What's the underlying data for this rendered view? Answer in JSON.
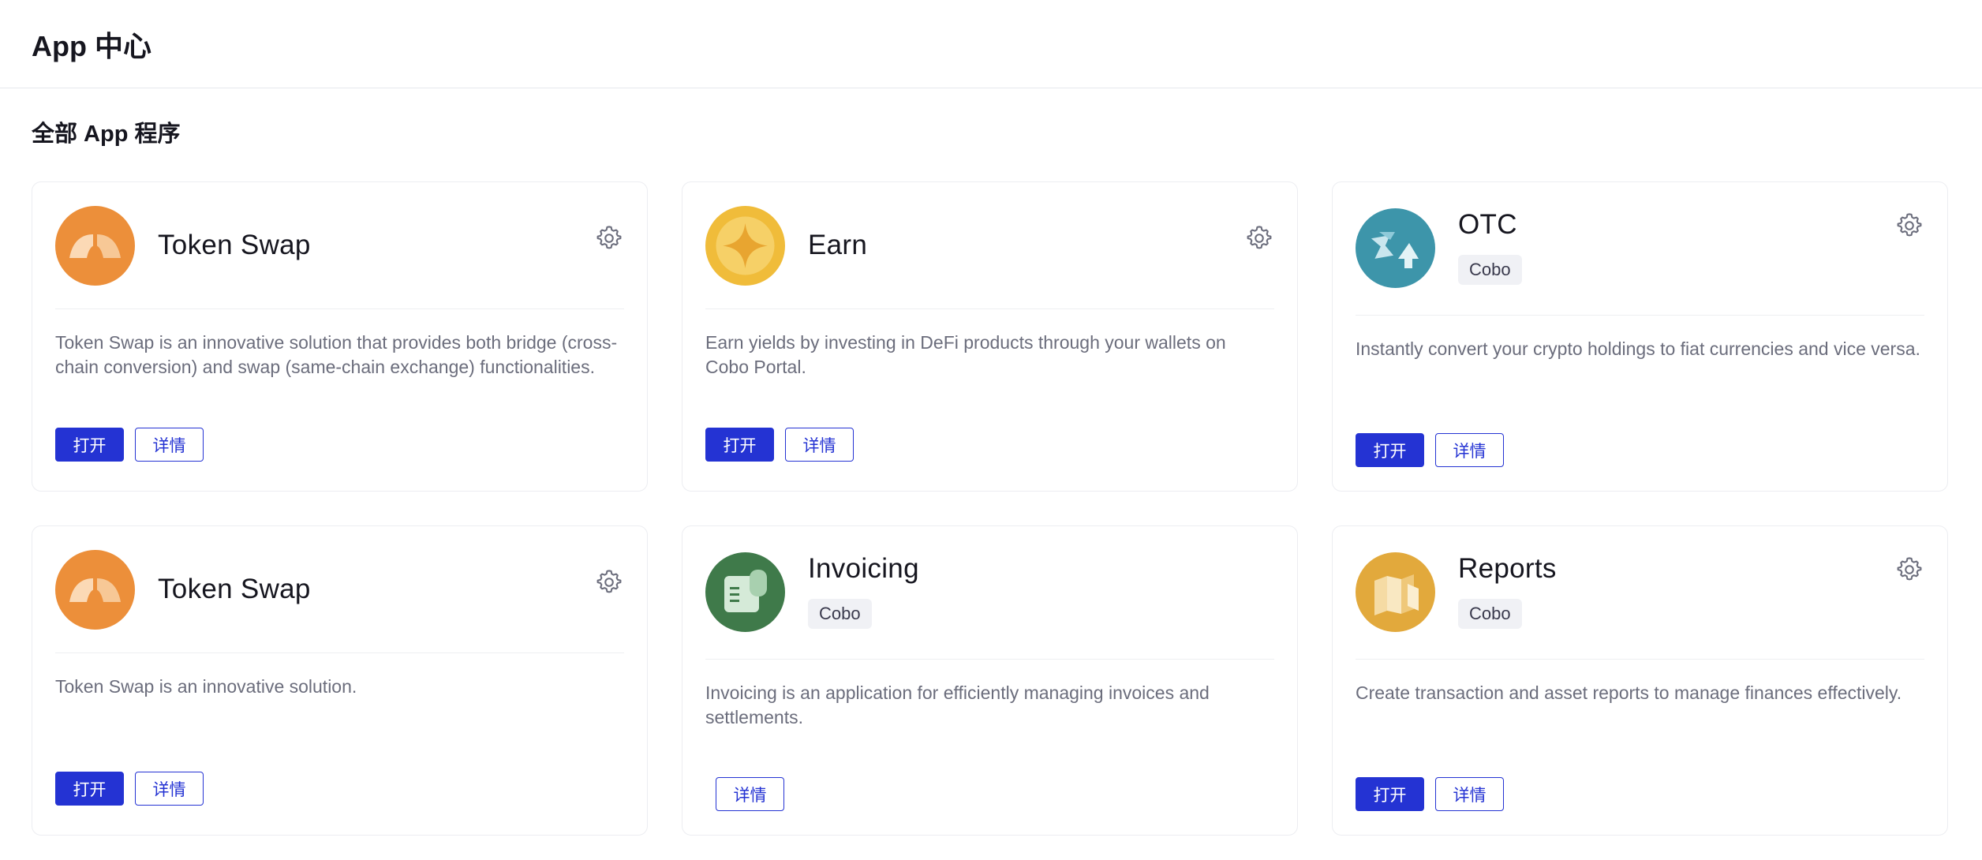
{
  "header": {
    "title": "App 中心"
  },
  "section": {
    "title": "全部 App 程序"
  },
  "buttons": {
    "open_label": "打开",
    "details_label": "详情"
  },
  "colors": {
    "primary": "#2433d3",
    "token_swap": "#ec8f3a",
    "earn": "#f0bc3a",
    "otc": "#3d95aa",
    "invoicing": "#3f7a4a",
    "reports": "#e2a93c"
  },
  "cards": [
    {
      "title": "Token Swap",
      "icon": "token-swap-icon",
      "description": "Token Swap is an innovative solution that provides both bridge (cross-chain conversion) and swap (same-chain exchange) functionalities.",
      "has_open": true,
      "has_settings": true
    },
    {
      "title": "Earn",
      "icon": "earn-icon",
      "description": "Earn yields by investing in DeFi products through your wallets on Cobo Portal.",
      "has_open": true,
      "has_settings": true
    },
    {
      "title": "OTC",
      "tag": "Cobo",
      "icon": "otc-icon",
      "description": "Instantly convert your crypto holdings to fiat currencies and vice versa.",
      "has_open": true,
      "has_settings": true
    },
    {
      "title": "Token Swap",
      "icon": "token-swap-icon",
      "description": "Token Swap is an innovative solution.",
      "has_open": true,
      "has_settings": true
    },
    {
      "title": "Invoicing",
      "tag": "Cobo",
      "icon": "invoicing-icon",
      "description": "Invoicing is an application for efficiently managing invoices and settlements.",
      "has_open": false,
      "has_settings": false
    },
    {
      "title": "Reports",
      "tag": "Cobo",
      "icon": "reports-icon",
      "description": "Create transaction and asset reports to manage finances effectively.",
      "has_open": true,
      "has_settings": true
    }
  ]
}
